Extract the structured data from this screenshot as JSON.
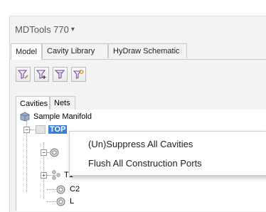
{
  "app": {
    "title": "MDTools 770",
    "title_caret": "▾"
  },
  "tabs": [
    {
      "label": "Model",
      "active": true
    },
    {
      "label": "Cavity Library",
      "active": false
    },
    {
      "label": "HyDraw Schematic",
      "active": false
    }
  ],
  "toolbar": {
    "buttons": [
      "funnel-edit-icon",
      "funnel-add-icon",
      "funnel-filter-icon",
      "funnel-settings-icon"
    ]
  },
  "subtabs": [
    {
      "label": "Cavities",
      "active": true
    },
    {
      "label": "Nets",
      "active": false
    }
  ],
  "tree": {
    "root_label": "Sample Manifold",
    "top_label": "TOP",
    "t1_label": "T1",
    "c2_label": "C2",
    "l_label": "L",
    "collapse_glyph": "−",
    "expand_glyph": "+"
  },
  "context_menu": {
    "items": [
      {
        "label": "(Un)Suppress All Cavities"
      },
      {
        "label": "Flush All Construction Ports"
      }
    ]
  },
  "colors": {
    "selection": "#3a80d6",
    "funnel_icon": "#8a5cb8"
  }
}
